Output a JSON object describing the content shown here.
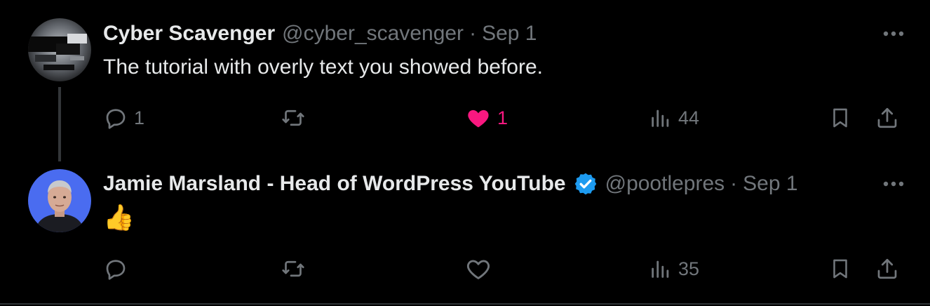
{
  "tweets": [
    {
      "display_name": "Cyber Scavenger",
      "handle": "@cyber_scavenger",
      "separator": "·",
      "date": "Sep 1",
      "text": "The tutorial with overly text you showed before.",
      "verified": false,
      "avatar_icon": "abstract-avatar",
      "liked": true,
      "stats": {
        "replies": "1",
        "retweets": "",
        "likes": "1",
        "views": "44"
      }
    },
    {
      "display_name": "Jamie Marsland - Head of WordPress YouTube",
      "handle": "@pootlepres",
      "separator": "·",
      "date": "Sep 1",
      "text": "👍",
      "verified": true,
      "avatar_icon": "person-photo-avatar",
      "liked": false,
      "stats": {
        "replies": "",
        "retweets": "",
        "likes": "",
        "views": "35"
      }
    }
  ],
  "colors": {
    "background": "#000000",
    "primary_text": "#e7e9ea",
    "secondary_text": "#71767b",
    "like": "#f91880",
    "verified": "#1d9bf0"
  },
  "icons": [
    "reply-icon",
    "retweet-icon",
    "like-icon",
    "views-icon",
    "bookmark-icon",
    "share-icon",
    "more-icon",
    "verified-icon"
  ]
}
